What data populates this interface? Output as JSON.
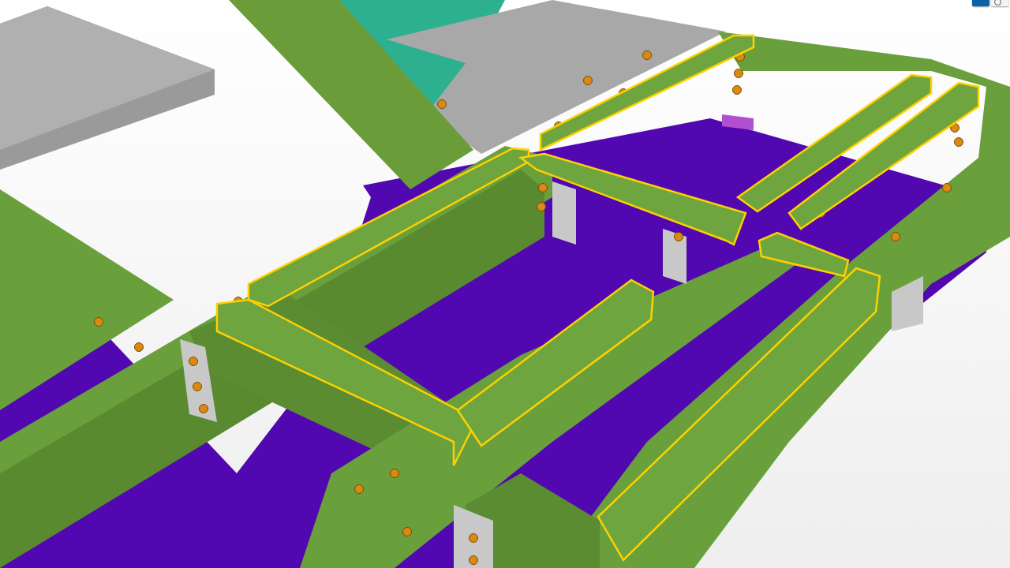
{
  "viewport": {
    "kind": "model",
    "toolbar": {
      "buttons": [
        {
          "kind": "square",
          "selected": true
        },
        {
          "kind": "circle",
          "selected": false
        }
      ]
    }
  }
}
